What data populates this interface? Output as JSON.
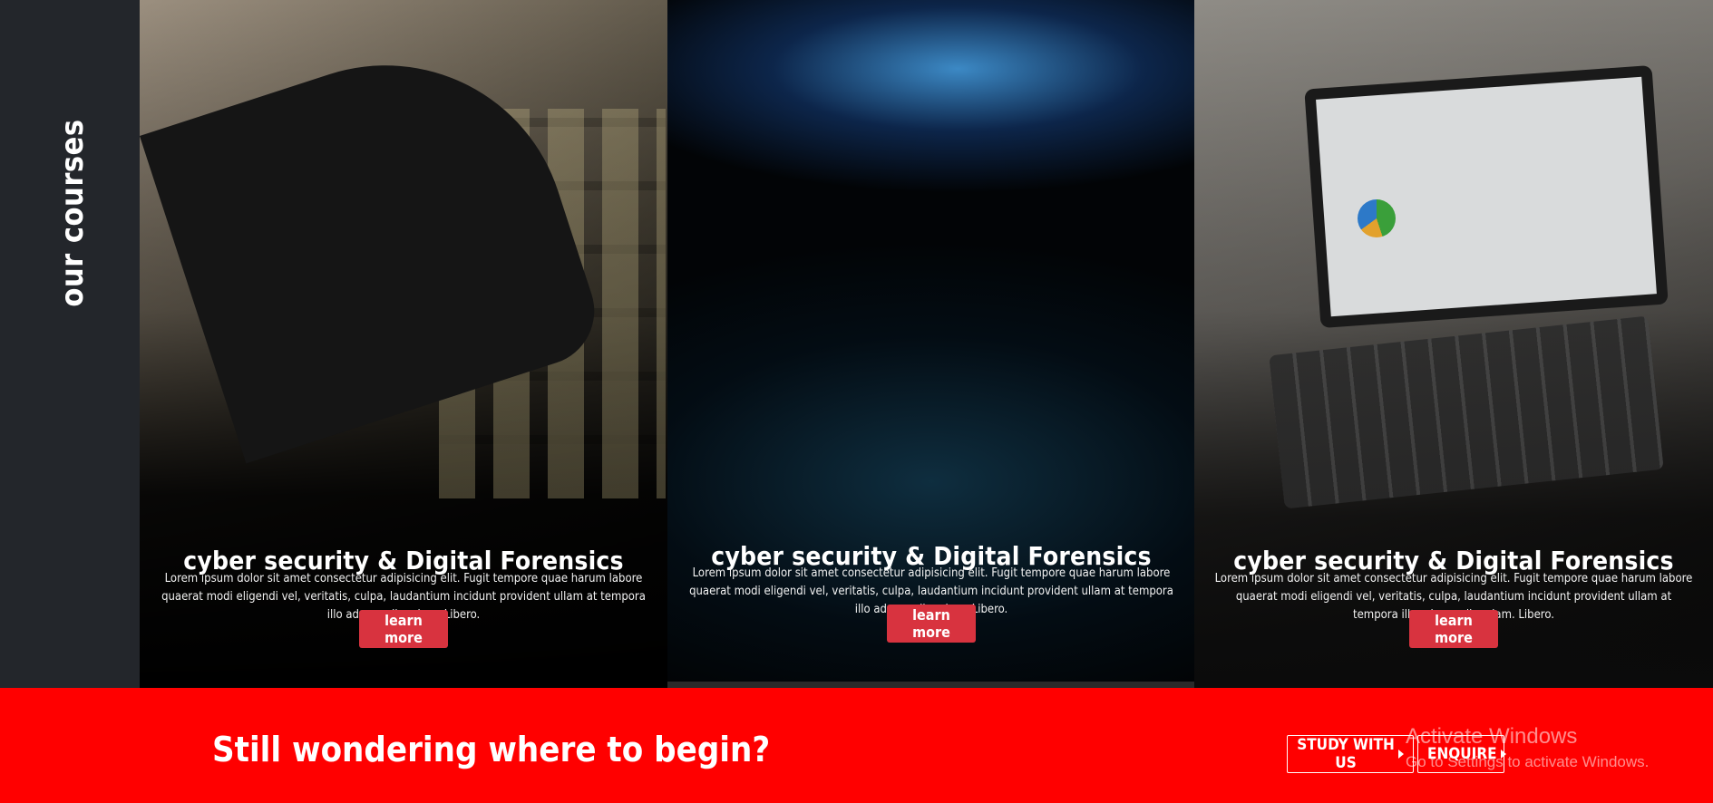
{
  "sidebar": {
    "title": "our courses"
  },
  "courses": [
    {
      "title": "cyber security & Digital Forensics",
      "description": "Lorem ipsum dolor sit amet consectetur adipisicing elit. Fugit tempore quae harum labore quaerat modi eligendi vel, veritatis, culpa, laudantium incidunt provident ullam at tempora illo ad ex quibusdam. Libero.",
      "button_label": "learn more"
    },
    {
      "title": "cyber security & Digital Forensics",
      "description": "Lorem ipsum dolor sit amet consectetur adipisicing elit. Fugit tempore quae harum labore quaerat modi eligendi vel, veritatis, culpa, laudantium incidunt provident ullam at tempora illo ad ex quibusdam. Libero.",
      "button_label": "learn more"
    },
    {
      "title": "cyber security & Digital Forensics",
      "description": "Lorem ipsum dolor sit amet consectetur adipisicing elit. Fugit tempore quae harum labore quaerat modi eligendi vel, veritatis, culpa, laudantium incidunt provident ullam at tempora illo ad ex quibusdam. Libero.",
      "button_label": "learn more"
    }
  ],
  "cta": {
    "title": "Still wondering where to begin?",
    "study_label": "STUDY WITH US",
    "enquire_label": "ENQUIRE"
  },
  "watermark": {
    "title": "Activate Windows",
    "subtitle": "Go to Settings to activate Windows."
  },
  "colors": {
    "accent_red": "#ff0000",
    "button_red": "#d8333f",
    "sidebar_bg": "#23262b"
  }
}
